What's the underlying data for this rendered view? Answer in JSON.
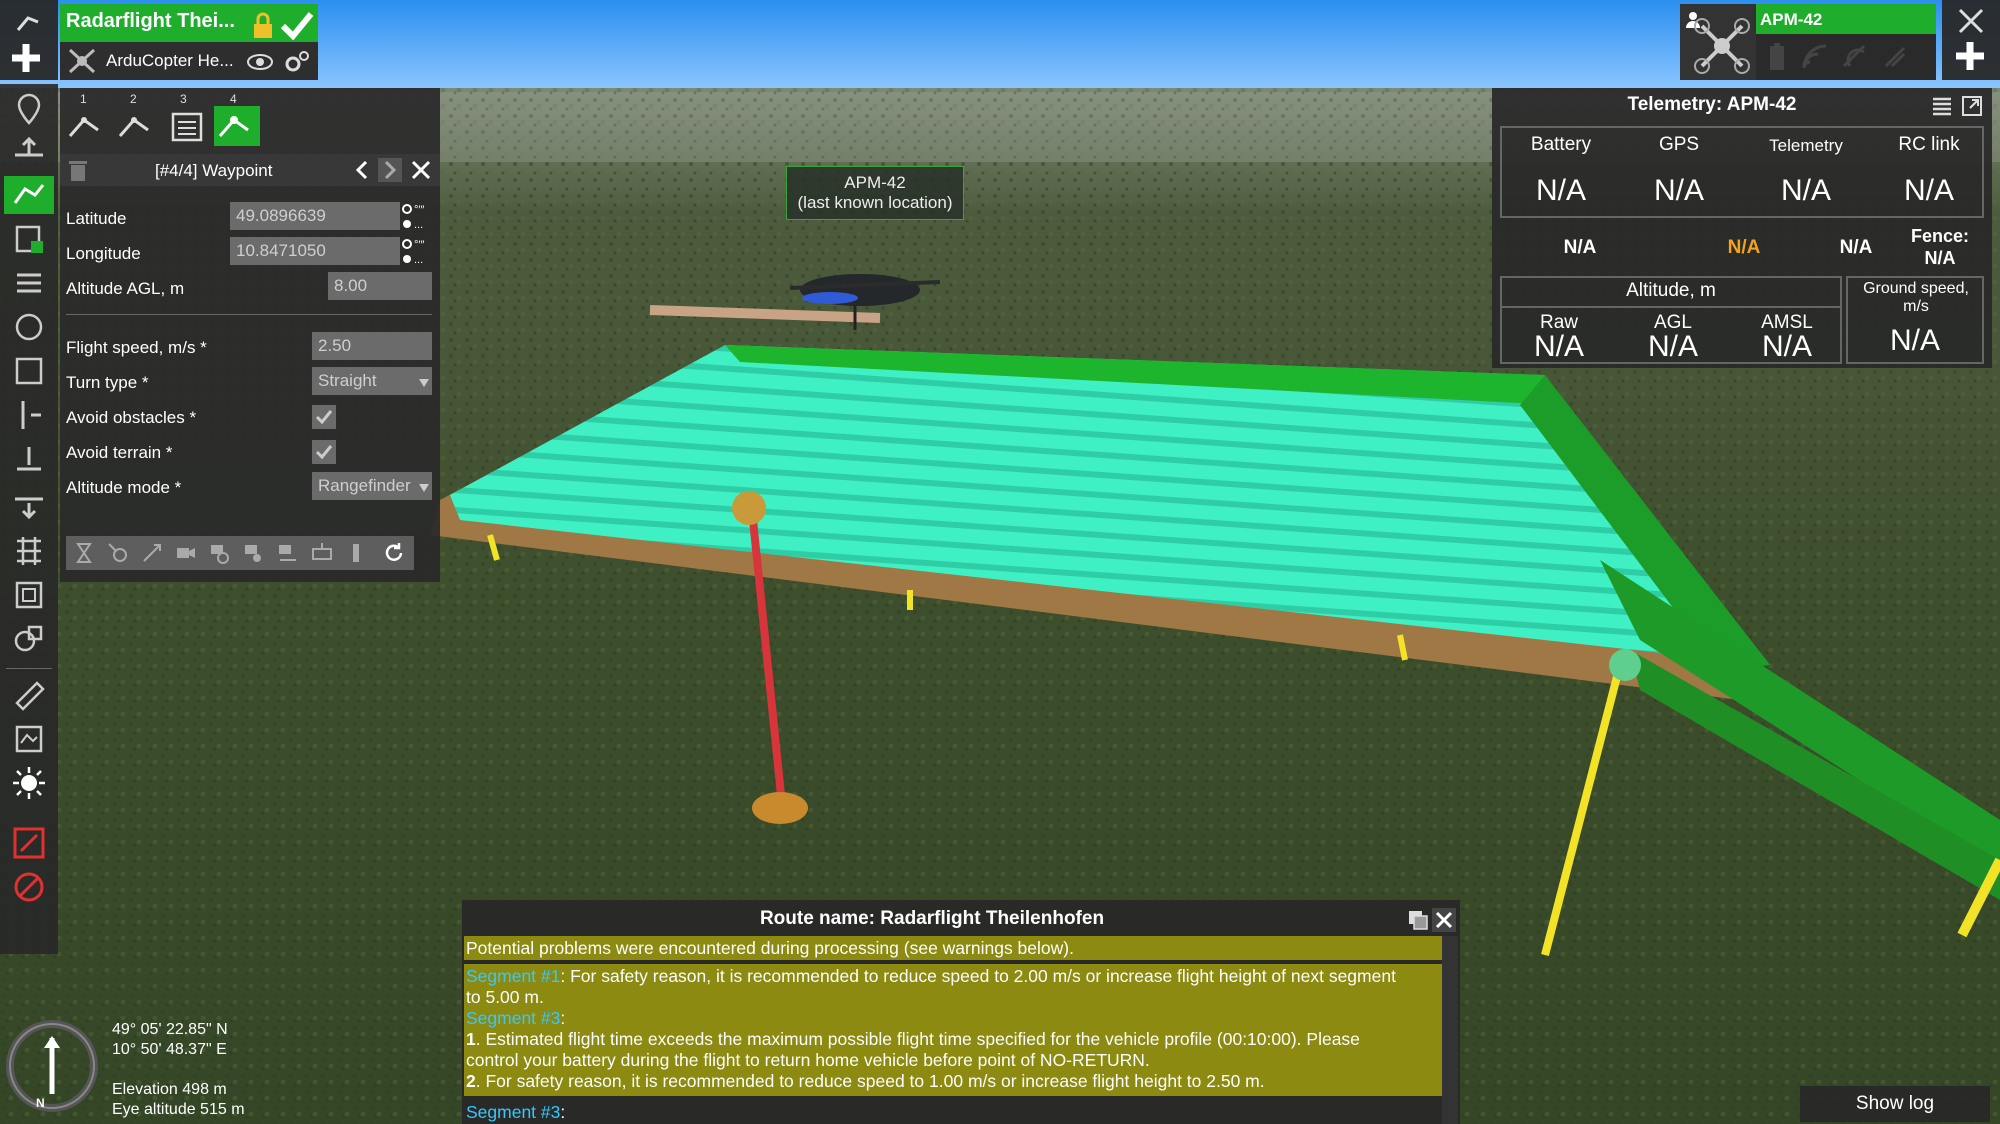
{
  "route_card": {
    "title": "Radarflight Thei...",
    "vehicle_profile": "ArduCopter He..."
  },
  "vehicle_card": {
    "name": "APM-42"
  },
  "waypoint_editor": {
    "tab_numbers": [
      "1",
      "2",
      "3",
      "4"
    ],
    "header": "[#4/4] Waypoint",
    "fields": {
      "latitude_label": "Latitude",
      "latitude_value": "49.0896639",
      "longitude_label": "Longitude",
      "longitude_value": "10.8471050",
      "altitude_label": "Altitude AGL, m",
      "altitude_value": "8.00",
      "speed_label": "Flight speed, m/s *",
      "speed_value": "2.50",
      "turn_label": "Turn type *",
      "turn_value": "Straight",
      "avoid_obstacles_label": "Avoid obstacles *",
      "avoid_terrain_label": "Avoid terrain *",
      "altitude_mode_label": "Altitude mode *",
      "altitude_mode_value": "Rangefinder"
    }
  },
  "map_label": {
    "line1": "APM-42",
    "line2": "(last known location)"
  },
  "telemetry": {
    "title": "Telemetry: APM-42",
    "battery": "Battery",
    "gps": "GPS",
    "telemetry": "Telemetry",
    "rc_link": "RC link",
    "battery_val": "N/A",
    "gps_val": "N/A",
    "telemetry_val": "N/A",
    "rc_val": "N/A",
    "row2_a": "N/A",
    "row2_b": "N/A",
    "row2_c": "N/A",
    "fence_label": "Fence:",
    "fence_val": "N/A",
    "altitude_header": "Altitude, m",
    "raw": "Raw",
    "agl": "AGL",
    "amsl": "AMSL",
    "raw_val": "N/A",
    "agl_val": "N/A",
    "amsl_val": "N/A",
    "ground_speed": "Ground speed, m/s",
    "ground_speed_val": "N/A"
  },
  "route_log": {
    "title": "Route name: Radarflight Theilenhofen",
    "summary": "Potential problems were encountered during processing (see warnings below).",
    "seg1_label": "Segment #1",
    "seg1_text": ": For safety reason, it is recommended to reduce speed to 2.00 m/s or increase flight height of next segment",
    "seg1_text2": "to 5.00 m.",
    "seg3_label": "Segment #3",
    "seg3_colon": ":",
    "item1_num": "1",
    "item1_text": ". Estimated flight time exceeds the maximum possible flight time specified for the vehicle profile (00:10:00). Please",
    "item1_text2": "control your battery during the flight to return home vehicle before point of NO-RETURN.",
    "item2_num": "2",
    "item2_text": ". For safety reason, it is recommended to reduce speed to 1.00 m/s or increase flight height to 2.50 m.",
    "seg3b_label": "Segment #3",
    "seg3b_colon": ":"
  },
  "show_log": "Show log",
  "coords": {
    "lat": "49° 05' 22.85\" N",
    "lon": "10° 50' 48.37\" E",
    "elevation": "Elevation 498 m",
    "eye": "Eye altitude 515 m"
  },
  "compass": {
    "n": "N"
  },
  "colors": {
    "accent_green": "#1fae2c",
    "route_cyan": "#3ff0c4",
    "warning_bg": "#8c8a10",
    "segment_link": "#34c9ff",
    "orange_na": "#f3a21a",
    "pole_red": "#d8343c",
    "pole_yellow": "#f2e326"
  },
  "icons": {
    "left_toolbar": [
      "route-icon",
      "waypoint-marker-icon",
      "takeoff-icon",
      "route-active-icon",
      "parking-icon",
      "list-icon",
      "circle-icon",
      "area-icon",
      "vertical-icon",
      "landing-icon",
      "land-icon",
      "grid-icon",
      "frame-icon",
      "shapes-icon",
      "ruler-icon",
      "map-layers-icon",
      "sun-icon",
      "no-entry-icon",
      "stop-icon"
    ]
  }
}
